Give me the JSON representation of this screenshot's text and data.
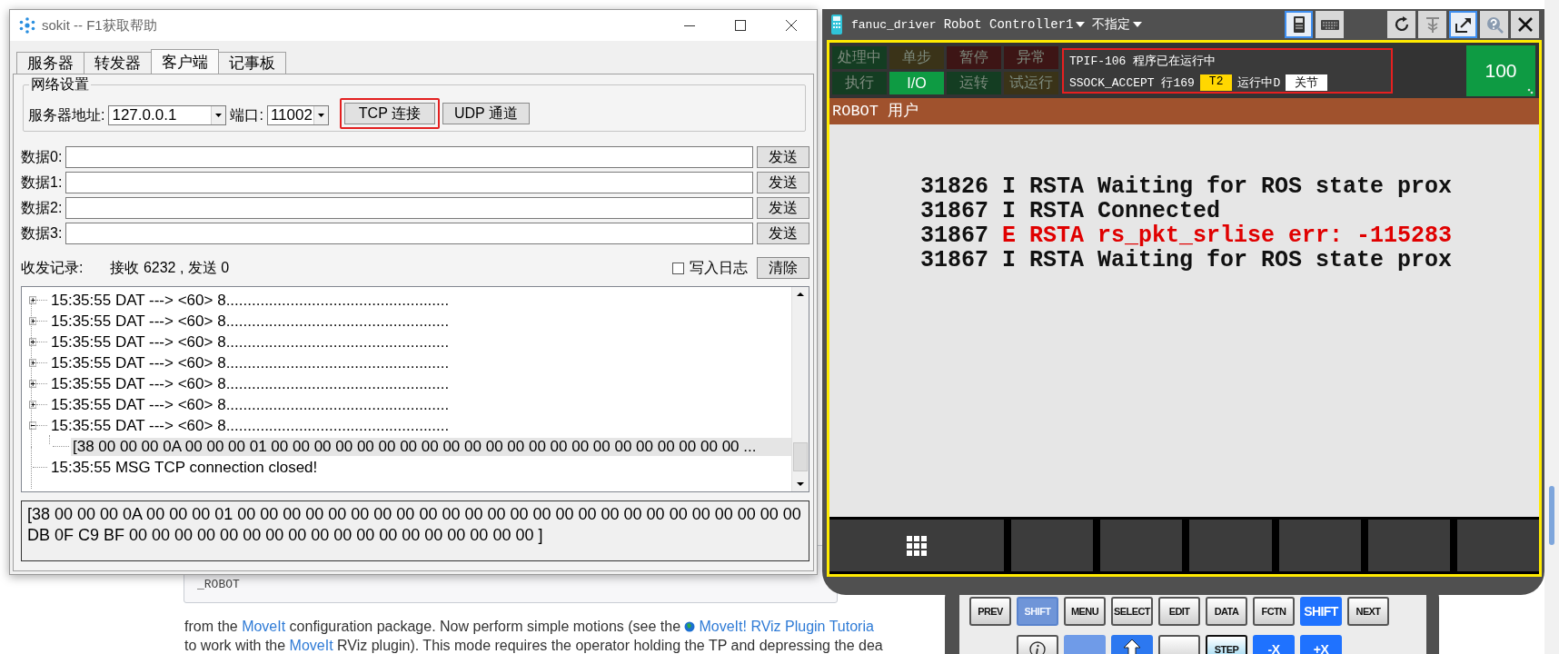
{
  "background_page": {
    "code_text": "_ROBOT",
    "paragraph_lines": [
      [
        {
          "kind": "text",
          "text": "from the "
        },
        {
          "kind": "link",
          "text": "MoveIt"
        },
        {
          "kind": "text",
          "text": " configuration package. Now perform simple motions (see the "
        },
        {
          "kind": "icon-link",
          "text": "MoveIt! RViz Plugin Tutoria"
        }
      ],
      [
        {
          "kind": "text",
          "text": "to work with the "
        },
        {
          "kind": "link",
          "text": "MoveIt"
        },
        {
          "kind": "text",
          "text": " RViz plugin). This mode requires the operator holding the TP and depressing the dea"
        }
      ]
    ]
  },
  "sokit": {
    "title": "sokit -- F1获取帮助",
    "tabs": [
      {
        "label": "服务器",
        "selected": false
      },
      {
        "label": "转发器",
        "selected": false
      },
      {
        "label": "客户端",
        "selected": true
      },
      {
        "label": "记事板",
        "selected": false
      }
    ],
    "group_title": "网络设置",
    "server_label": "服务器地址:",
    "server_value": "127.0.0.1",
    "port_label": "端口:",
    "port_value": "11002",
    "buttons": [
      {
        "label": "TCP 连接",
        "highlighted": true
      },
      {
        "label": "UDP 通道",
        "highlighted": false
      }
    ],
    "data_rows": [
      {
        "label": "数据0:",
        "button": "发送"
      },
      {
        "label": "数据1:",
        "button": "发送"
      },
      {
        "label": "数据2:",
        "button": "发送"
      },
      {
        "label": "数据3:",
        "button": "发送"
      }
    ],
    "log_label": "收发记录:",
    "log_counts": "接收 6232 , 发送 0",
    "log_checkbox": {
      "label": "写入日志",
      "checked": false
    },
    "clear_button": "清除",
    "log_entries": [
      {
        "kind": "node",
        "text": "15:35:55 DAT ---> <60> 8....................................................",
        "expanded": false
      },
      {
        "kind": "node",
        "text": "15:35:55 DAT ---> <60> 8....................................................",
        "expanded": false
      },
      {
        "kind": "node",
        "text": "15:35:55 DAT ---> <60> 8....................................................",
        "expanded": false
      },
      {
        "kind": "node",
        "text": "15:35:55 DAT ---> <60> 8....................................................",
        "expanded": false
      },
      {
        "kind": "node",
        "text": "15:35:55 DAT ---> <60> 8....................................................",
        "expanded": false
      },
      {
        "kind": "node",
        "text": "15:35:55 DAT ---> <60> 8....................................................",
        "expanded": false
      },
      {
        "kind": "node",
        "text": "15:35:55 DAT ---> <60> 8....................................................",
        "expanded": true,
        "children": [
          {
            "text": "[38 00 00 00 0A 00 00 00 01 00 00 00 00 00 00 00 00 00 00 00 00 00 00 00 00 00 00 00 00 00 00 ...",
            "selected": true
          }
        ]
      },
      {
        "kind": "leaf",
        "text": "15:35:55 MSG TCP connection closed!"
      }
    ],
    "detail_text": "[38 00 00 00 0A 00 00 00 01 00 00 00 00 00 00 00 00 00 00 00 00 00 00 00 00 00 00 00 00 00 00 00 00 00 DB 0F C9 BF 00 00 00 00 00 00 00 00 00 00 00 00 00 00 00 00 00 00 ]"
  },
  "pendant": {
    "app_name": "fanuc_driver",
    "controller": "Robot Controller1",
    "mode": "不指定",
    "toolbar_buttons": [
      {
        "kind": "pendant",
        "selected": true
      },
      {
        "kind": "keyboard",
        "selected": false
      },
      {
        "kind": "refresh",
        "selected": false
      },
      {
        "kind": "jog",
        "selected": false
      },
      {
        "kind": "export",
        "selected": true
      },
      {
        "kind": "help",
        "selected": false
      },
      {
        "kind": "close",
        "selected": false
      }
    ],
    "status_tiles": [
      {
        "label": "处理中",
        "color": "#143d22",
        "on": false
      },
      {
        "label": "单步",
        "color": "#3a3318",
        "on": false
      },
      {
        "label": "暂停",
        "color": "#3d1515",
        "on": false
      },
      {
        "label": "异常",
        "color": "#3d1515",
        "on": false
      },
      {
        "label": "执行",
        "color": "#143d22",
        "on": false
      },
      {
        "label": "I/O",
        "color": "#0e9b43",
        "on": true
      },
      {
        "label": "运转",
        "color": "#143d22",
        "on": false
      },
      {
        "label": "试运行",
        "color": "#3a3318",
        "on": false
      }
    ],
    "message": {
      "highlighted": true,
      "line1": "TPIF-106 程序已在运行中",
      "line2": [
        {
          "text": "SSOCK_ACCEPT 行169"
        },
        {
          "text": "T2",
          "color": "#ffd700"
        },
        {
          "text": "运行中D"
        },
        {
          "text": "关节",
          "color": "#ffffff"
        }
      ]
    },
    "override": "100",
    "screen_title": "ROBOT 用户",
    "log_lines": [
      {
        "kind": "info",
        "number": "31826",
        "level": "I",
        "message": "RSTA Waiting for ROS state prox"
      },
      {
        "kind": "info",
        "number": "31867",
        "level": "I",
        "message": "RSTA Connected"
      },
      {
        "kind": "error",
        "number": "31867",
        "level": "E",
        "message": "RSTA rs_pkt_srlise err: -115283"
      },
      {
        "kind": "info",
        "number": "31867",
        "level": "I",
        "message": "RSTA Waiting for ROS state prox"
      }
    ],
    "function_keys": [
      {
        "kind": "menu-grid"
      },
      {
        "kind": "blank"
      },
      {
        "kind": "blank"
      },
      {
        "kind": "blank"
      },
      {
        "kind": "blank"
      },
      {
        "kind": "blank"
      },
      {
        "kind": "blank"
      }
    ],
    "keys": [
      {
        "kind": "plain",
        "label": "PREV"
      },
      {
        "kind": "faded",
        "label": "SHIFT"
      },
      {
        "kind": "plain",
        "label": "MENU"
      },
      {
        "kind": "plain",
        "label": "SELECT"
      },
      {
        "kind": "plain",
        "label": "EDIT"
      },
      {
        "kind": "plain",
        "label": "DATA"
      },
      {
        "kind": "plain",
        "label": "FCTN"
      },
      {
        "kind": "blue",
        "label": "SHIFT"
      },
      {
        "kind": "plain",
        "label": "NEXT"
      }
    ],
    "lower_keys": [
      {
        "kind": "info"
      },
      {
        "kind": "blue-blank"
      },
      {
        "kind": "arrow-up"
      },
      {
        "kind": "blank"
      },
      {
        "kind": "step",
        "label": "STEP"
      },
      {
        "kind": "blue",
        "label": "-X"
      },
      {
        "kind": "blue",
        "label": "+X"
      }
    ]
  }
}
